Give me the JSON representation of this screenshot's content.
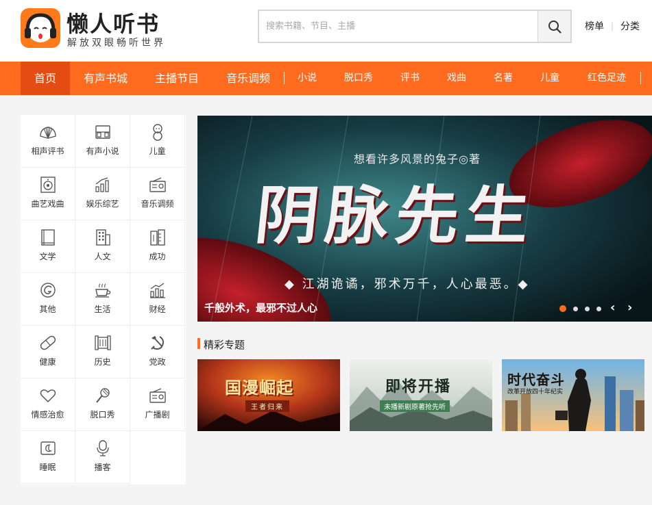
{
  "header": {
    "brand": "懒人听书",
    "slogan": "解放双眼畅听世界",
    "search_placeholder": "搜索书籍、节目、主播",
    "search_icon": "search-icon",
    "links": [
      "榜单",
      "分类"
    ]
  },
  "nav": {
    "items": [
      "首页",
      "有声书城",
      "主播节目",
      "音乐调频",
      "小说",
      "脱口秀",
      "评书",
      "戏曲",
      "名著",
      "儿童",
      "红色足迹"
    ],
    "active_index": 0,
    "accent": "#ff6b1f",
    "active_color": "#e44c12"
  },
  "categories": [
    {
      "label": "相声评书",
      "icon": "fan-icon"
    },
    {
      "label": "有声小说",
      "icon": "headphones-icon"
    },
    {
      "label": "儿童",
      "icon": "baby-icon"
    },
    {
      "label": "曲艺戏曲",
      "icon": "speaker-icon"
    },
    {
      "label": "娱乐综艺",
      "icon": "bar-chart-icon"
    },
    {
      "label": "音乐调频",
      "icon": "radio-icon"
    },
    {
      "label": "文学",
      "icon": "book-icon"
    },
    {
      "label": "人文",
      "icon": "building-icon"
    },
    {
      "label": "成功",
      "icon": "ruler-book-icon"
    },
    {
      "label": "其他",
      "icon": "g-circle-icon"
    },
    {
      "label": "生活",
      "icon": "coffee-cup-icon"
    },
    {
      "label": "财经",
      "icon": "growth-chart-icon"
    },
    {
      "label": "健康",
      "icon": "pill-icon"
    },
    {
      "label": "历史",
      "icon": "scroll-icon"
    },
    {
      "label": "党政",
      "icon": "hammer-sickle-icon"
    },
    {
      "label": "情感治愈",
      "icon": "heart-icon"
    },
    {
      "label": "脱口秀",
      "icon": "microphone-icon"
    },
    {
      "label": "广播剧",
      "icon": "radio-icon"
    },
    {
      "label": "睡眠",
      "icon": "moon-icon"
    },
    {
      "label": "播客",
      "icon": "podcast-mic-icon"
    }
  ],
  "banner": {
    "author": "想看许多风景的兔子◎著",
    "title": "阴脉先生",
    "subtitle": "◆ 江湖诡谲，邪术万千，人心最恶。◆",
    "caption": "千般外术，最邪不过人心",
    "slides": 4,
    "active_slide": 0,
    "prev_icon": "chevron-left-icon",
    "next_icon": "chevron-right-icon"
  },
  "topics": {
    "title": "精彩专题",
    "cards": [
      {
        "main": "国漫崛起",
        "sub": "王者归来"
      },
      {
        "main": "即将开播",
        "sub": "未播新剧原著抢先听"
      },
      {
        "main": "时代奋斗",
        "sub": "改革开放四十年纪实"
      }
    ]
  }
}
